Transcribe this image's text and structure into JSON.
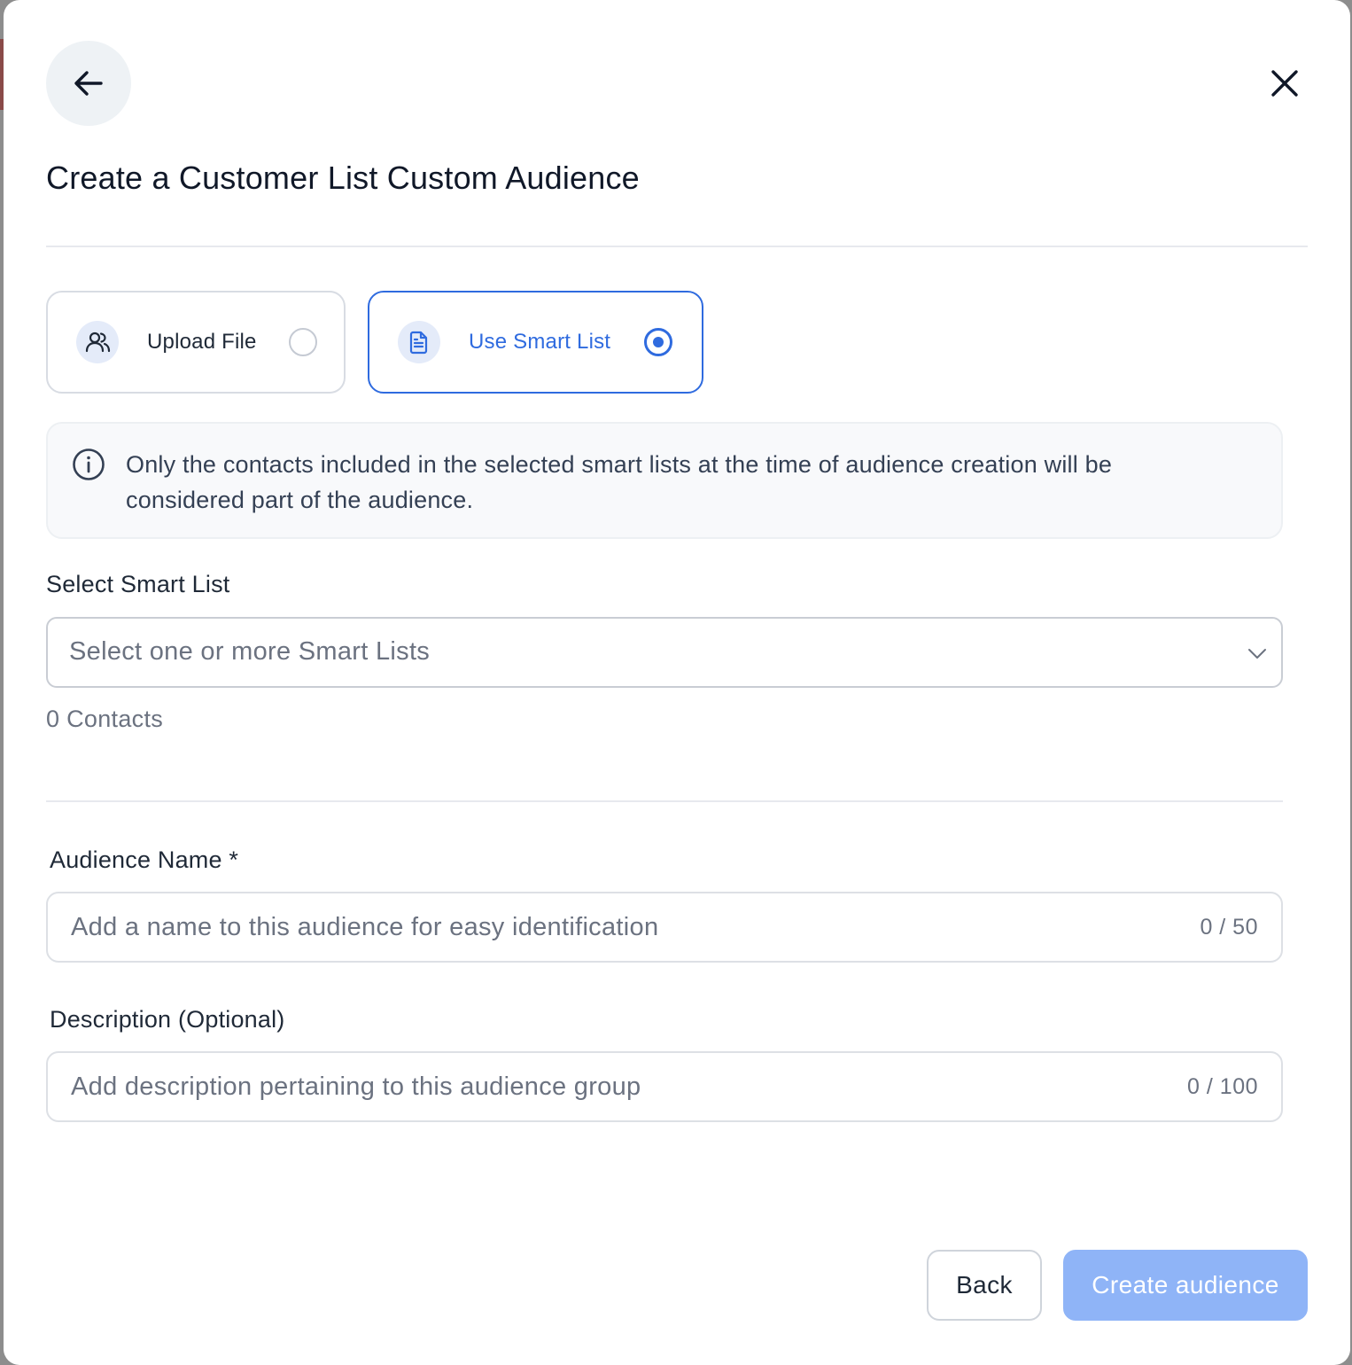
{
  "modal": {
    "title": "Create a Customer List Custom Audience"
  },
  "source_options": [
    {
      "label": "Upload File",
      "icon": "users-icon",
      "selected": false
    },
    {
      "label": "Use Smart List",
      "icon": "document-icon",
      "selected": true
    }
  ],
  "info": {
    "icon": "info-icon",
    "text": "Only the contacts included in the selected smart lists at the time of audience creation will be considered part of the audience."
  },
  "smart_list": {
    "label": "Select Smart List",
    "placeholder": "Select one or more Smart Lists",
    "contacts_count": "0 Contacts"
  },
  "audience_name": {
    "label": "Audience Name *",
    "placeholder": "Add a name to this audience for easy identification",
    "value": "",
    "counter": "0 / 50"
  },
  "description": {
    "label": "Description (Optional)",
    "placeholder": "Add description pertaining to this audience group",
    "value": "",
    "counter": "0 / 100"
  },
  "footer": {
    "back_label": "Back",
    "create_label": "Create audience"
  },
  "colors": {
    "accent": "#2f6bdf",
    "create_button_disabled": "#8fb4f7"
  }
}
